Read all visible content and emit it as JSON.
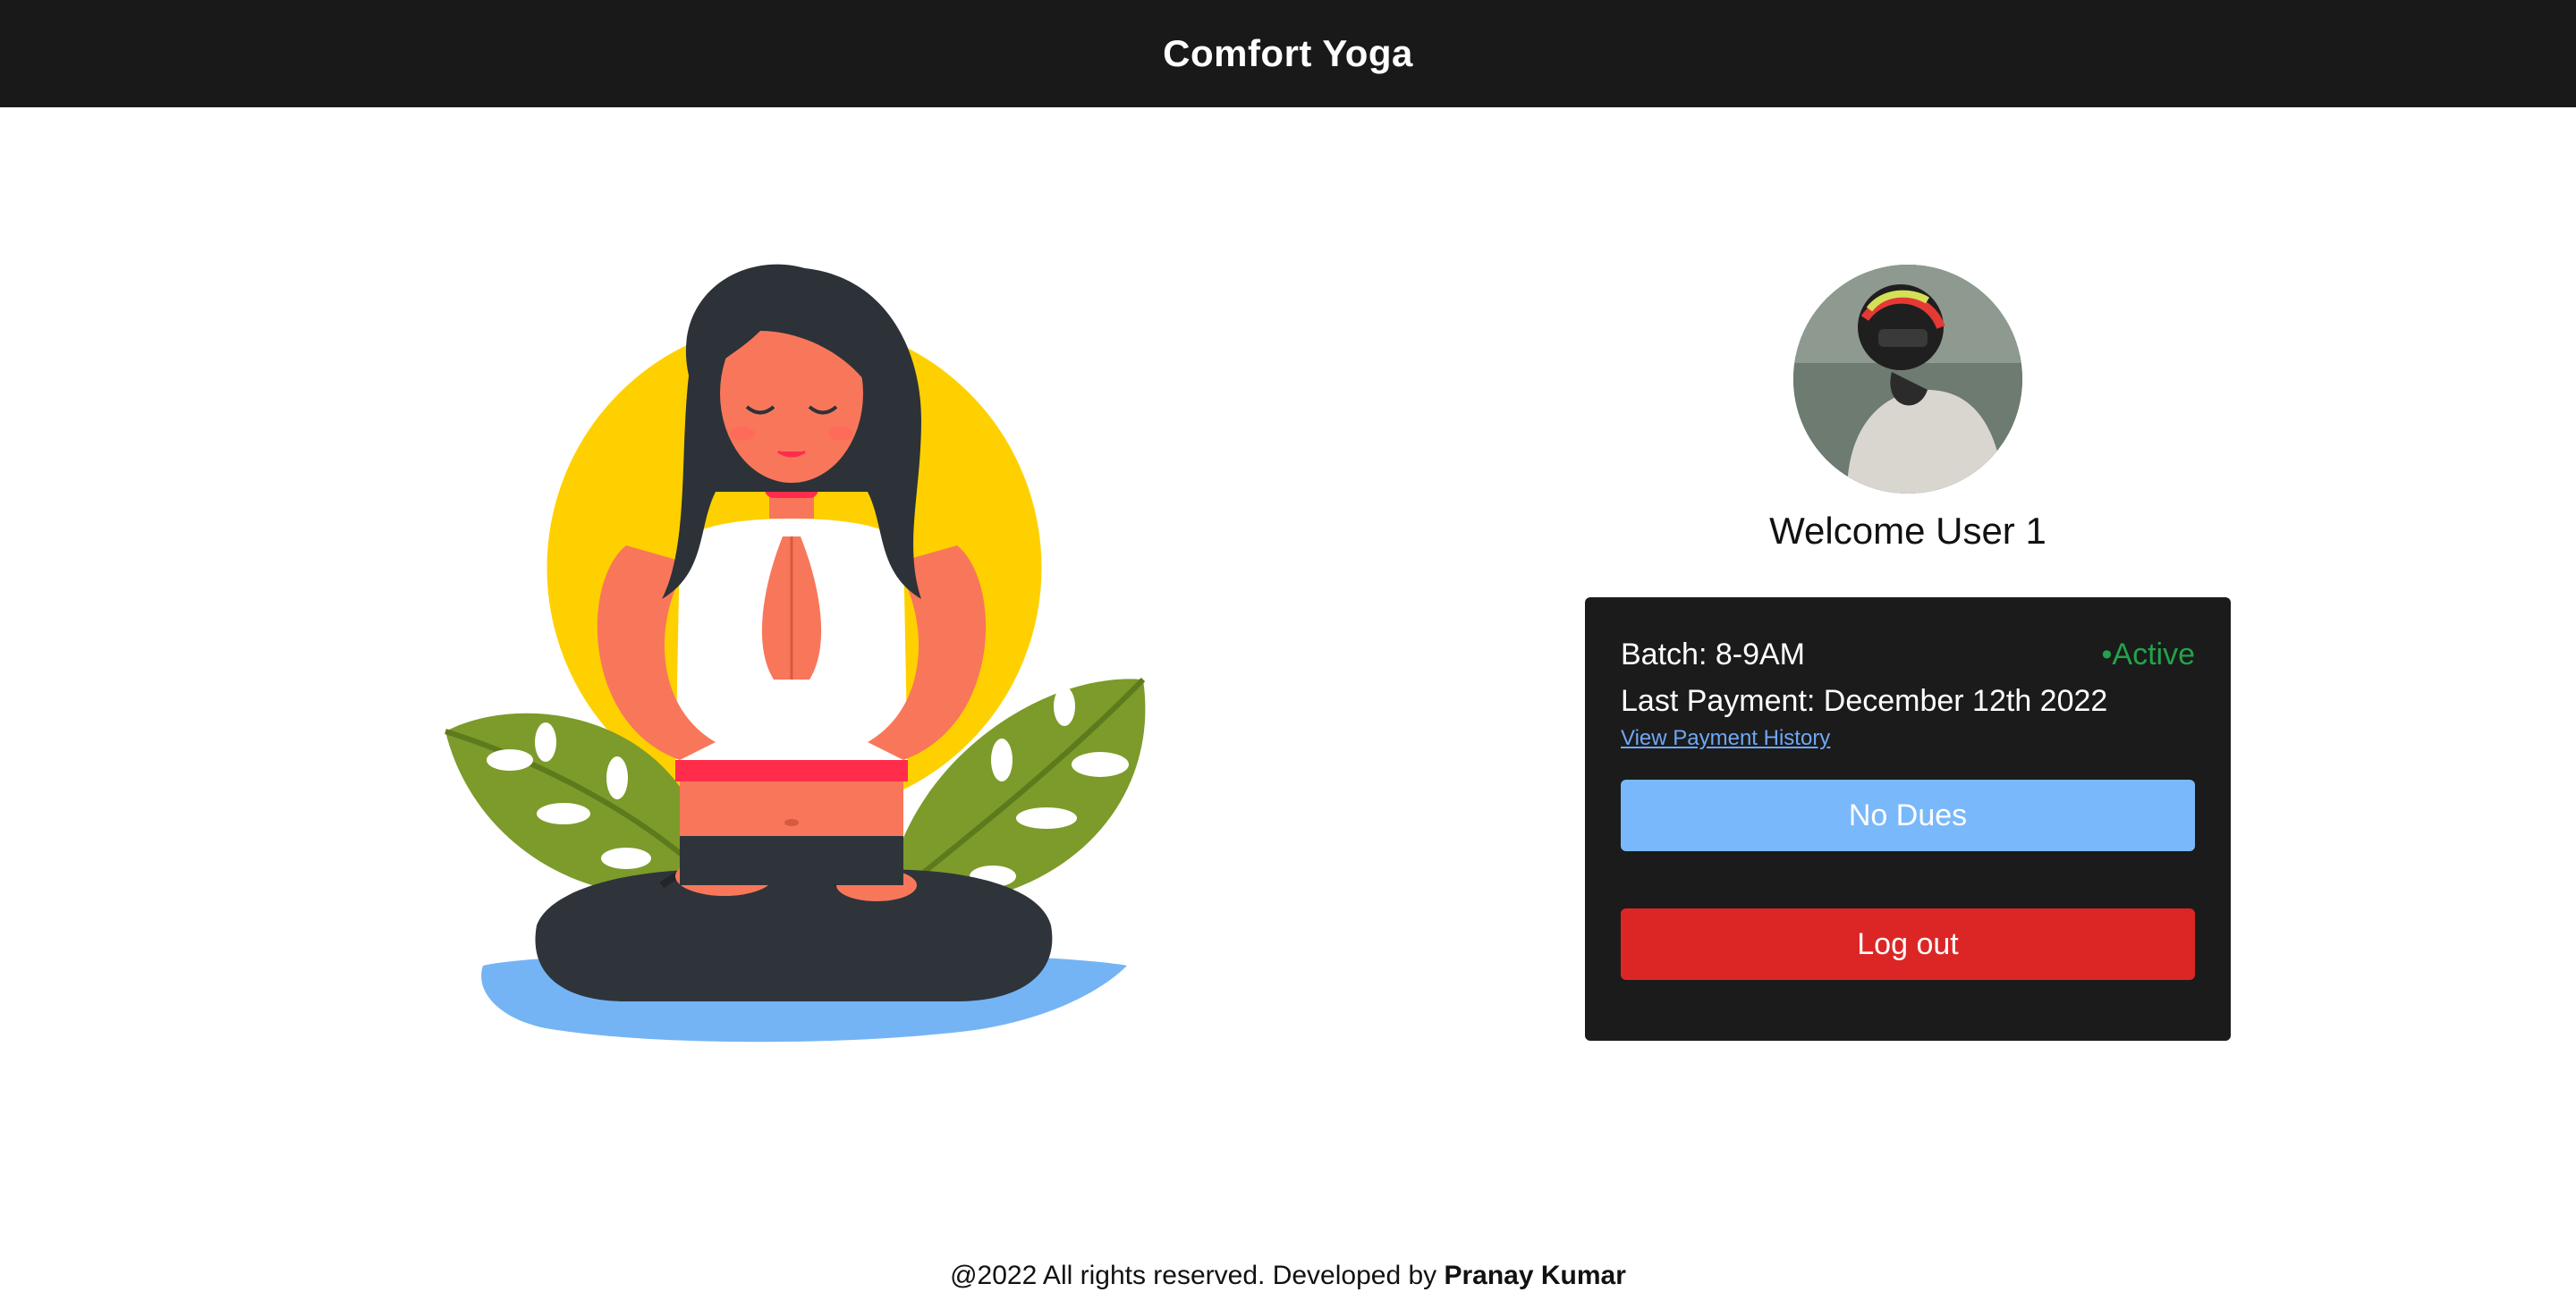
{
  "header": {
    "title": "Comfort Yoga"
  },
  "profile": {
    "welcome": "Welcome User 1"
  },
  "card": {
    "batch": "Batch: 8-9AM",
    "status": "•Active",
    "last_payment": "Last Payment: December 12th 2022",
    "history_link": "View Payment History",
    "dues_button": "No Dues",
    "logout_button": "Log out"
  },
  "footer": {
    "text": "@2022 All rights reserved. Developed by ",
    "developer": "Pranay Kumar"
  },
  "colors": {
    "header_bg": "#191919",
    "card_bg": "#1b1b1b",
    "status_green": "#22a34a",
    "dues_blue": "#79b8fa",
    "logout_red": "#dc2626",
    "link_blue": "#6ea8f5"
  },
  "icons": {
    "illustration": "meditating-woman-illustration",
    "avatar": "user-avatar-photo"
  }
}
